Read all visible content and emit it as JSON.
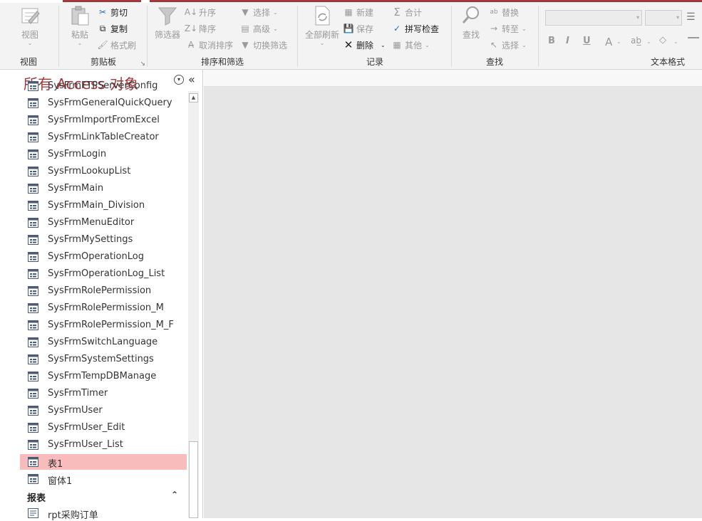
{
  "ribbon": {
    "view_group": {
      "big_label": "视图",
      "group_label": "视图"
    },
    "clipboard": {
      "paste": "粘贴",
      "cut": "剪切",
      "copy": "复制",
      "format_painter": "格式刷",
      "group_label": "剪贴板"
    },
    "sort_filter": {
      "filter": "筛选器",
      "ascending": "升序",
      "descending": "降序",
      "clear_sort": "取消排序",
      "selection": "选择",
      "advanced": "高级",
      "toggle_filter": "切换筛选",
      "group_label": "排序和筛选"
    },
    "records": {
      "refresh_all": "全部刷新",
      "new": "新建",
      "save": "保存",
      "delete": "删除",
      "totals": "合计",
      "spelling": "拼写检查",
      "more": "其他",
      "group_label": "记录"
    },
    "find": {
      "find": "查找",
      "replace": "替换",
      "goto": "转至",
      "select": "选择",
      "group_label": "查找"
    },
    "text_format": {
      "bold": "B",
      "italic": "I",
      "underline": "U",
      "font_color": "A",
      "group_label": "文本格式"
    }
  },
  "nav_pane": {
    "title": "所有 Access 对象",
    "items": [
      {
        "label": "SysFrmFTPServerConfig"
      },
      {
        "label": "SysFrmGeneralQuickQuery"
      },
      {
        "label": "SysFrmImportFromExcel"
      },
      {
        "label": "SysFrmLinkTableCreator"
      },
      {
        "label": "SysFrmLogin"
      },
      {
        "label": "SysFrmLookupList"
      },
      {
        "label": "SysFrmMain"
      },
      {
        "label": "SysFrmMain_Division"
      },
      {
        "label": "SysFrmMenuEditor"
      },
      {
        "label": "SysFrmMySettings"
      },
      {
        "label": "SysFrmOperationLog"
      },
      {
        "label": "SysFrmOperationLog_List"
      },
      {
        "label": "SysFrmRolePermission"
      },
      {
        "label": "SysFrmRolePermission_M"
      },
      {
        "label": "SysFrmRolePermission_M_F"
      },
      {
        "label": "SysFrmSwitchLanguage"
      },
      {
        "label": "SysFrmSystemSettings"
      },
      {
        "label": "SysFrmTempDBManage"
      },
      {
        "label": "SysFrmTimer"
      },
      {
        "label": "SysFrmUser"
      },
      {
        "label": "SysFrmUser_Edit"
      },
      {
        "label": "SysFrmUser_List"
      },
      {
        "label": "表1",
        "selected": true
      },
      {
        "label": "窗体1"
      }
    ],
    "section_reports": "报表",
    "partial_item": "rpt采购订单"
  },
  "colors": {
    "accent": "#a4373a",
    "selected_row": "#f8bcbc",
    "workspace": "#e6e6e6"
  }
}
